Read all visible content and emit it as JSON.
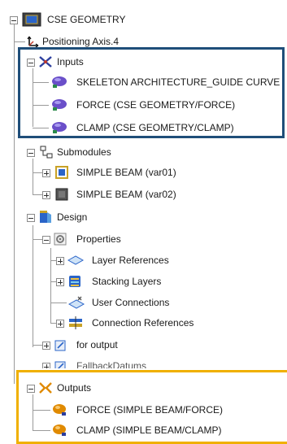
{
  "tree": {
    "root": {
      "label": "CSE GEOMETRY"
    },
    "positioning_axis": {
      "label": "Positioning Axis.4"
    },
    "inputs": {
      "label": "Inputs",
      "items": [
        {
          "label": "SKELETON ARCHITECTURE_GUIDE CURVE"
        },
        {
          "label": "FORCE (CSE GEOMETRY/FORCE)"
        },
        {
          "label": "CLAMP (CSE GEOMETRY/CLAMP)"
        }
      ]
    },
    "submodules": {
      "label": "Submodules",
      "items": [
        {
          "label": "SIMPLE BEAM (var01)"
        },
        {
          "label": "SIMPLE BEAM (var02)"
        }
      ]
    },
    "design": {
      "label": "Design",
      "properties": {
        "label": "Properties",
        "items": [
          {
            "label": "Layer References"
          },
          {
            "label": "Stacking Layers"
          },
          {
            "label": "User Connections"
          },
          {
            "label": "Connection References"
          }
        ]
      },
      "for_output": {
        "label": "for output"
      },
      "fallback": {
        "label": "FallbackDatums"
      }
    },
    "outputs": {
      "label": "Outputs",
      "items": [
        {
          "label": "FORCE (SIMPLE BEAM/FORCE)"
        },
        {
          "label": "CLAMP (SIMPLE BEAM/CLAMP)"
        }
      ]
    }
  },
  "highlight_colors": {
    "inputs_frame": "#1f4e79",
    "outputs_frame": "#f0b000"
  }
}
